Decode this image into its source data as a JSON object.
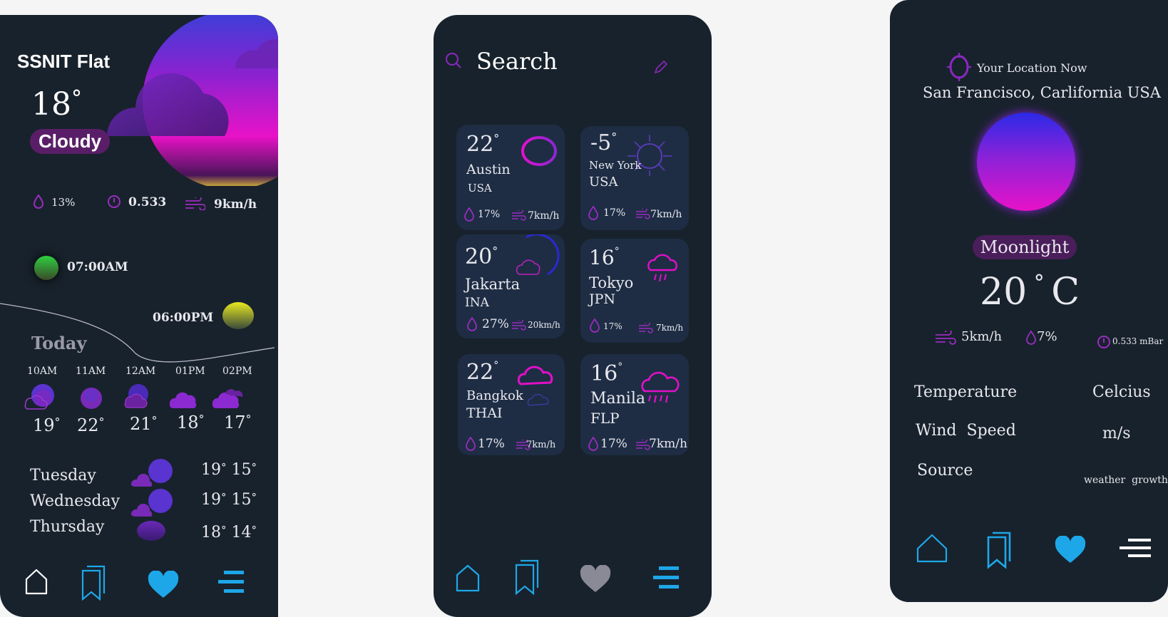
{
  "screen1": {
    "location": "SSNIT Flat",
    "temp": "18",
    "condition": "Cloudy",
    "humidity": "13%",
    "pressure": "0.533",
    "wind": "9km/h",
    "sunrise": "07:00AM",
    "sunset": "06:00PM",
    "today_label": "Today",
    "hourly": [
      {
        "time": "10AM",
        "temp": "19"
      },
      {
        "time": "11AM",
        "temp": "22"
      },
      {
        "time": "12AM",
        "temp": "21"
      },
      {
        "time": "01PM",
        "temp": "18"
      },
      {
        "time": "02PM",
        "temp": "17"
      }
    ],
    "daily": [
      {
        "day": "Tuesday",
        "high": "19",
        "low": "15"
      },
      {
        "day": "Wednesday",
        "high": "19",
        "low": "15"
      },
      {
        "day": "Thursday",
        "high": "18",
        "low": "14"
      }
    ],
    "colors": {
      "bg": "#18222c",
      "accent": "#e010d0",
      "purple": "#7a28b0",
      "nav": "#1ea7e8"
    }
  },
  "screen2": {
    "search_label": "Search",
    "cities": [
      {
        "temp": "22",
        "city": "Austin",
        "country": "USA",
        "humidity": "17%",
        "wind": "7km/h"
      },
      {
        "temp": "-5",
        "city": "New York",
        "country": "USA",
        "humidity": "17%",
        "wind": "7km/h"
      },
      {
        "temp": "20",
        "city": "Jakarta",
        "country": "INA",
        "humidity": "27%",
        "wind": "20km/h"
      },
      {
        "temp": "16",
        "city": "Tokyo",
        "country": "JPN",
        "humidity": "17%",
        "wind": "7km/h"
      },
      {
        "temp": "22",
        "city": "Bangkok",
        "country": "THAI",
        "humidity": "17%",
        "wind": "7km/h"
      },
      {
        "temp": "16",
        "city": "Manila",
        "country": "FLP",
        "humidity": "17%",
        "wind": "7km/h"
      }
    ]
  },
  "screen3": {
    "location_caption": "Your Location Now",
    "location": "San Francisco, Carlifornia USA",
    "condition": "Moonlight",
    "temp": "20",
    "unit": "C",
    "wind": "5km/h",
    "humidity": "7%",
    "pressure": "0.533 mBar",
    "settings": [
      {
        "label": "Temperature",
        "value": "Celcius"
      },
      {
        "label": "Wind  Speed",
        "value": "m/s"
      },
      {
        "label": "Source",
        "value": "weather  growth"
      }
    ]
  },
  "icons": [
    "drop-icon",
    "pressure-icon",
    "wind-icon",
    "search-icon",
    "edit-icon",
    "home-icon",
    "bookmark-icon",
    "heart-icon",
    "menu-icon",
    "location-icon",
    "cloud-icon",
    "rain-icon",
    "sun-icon",
    "moon-icon"
  ]
}
